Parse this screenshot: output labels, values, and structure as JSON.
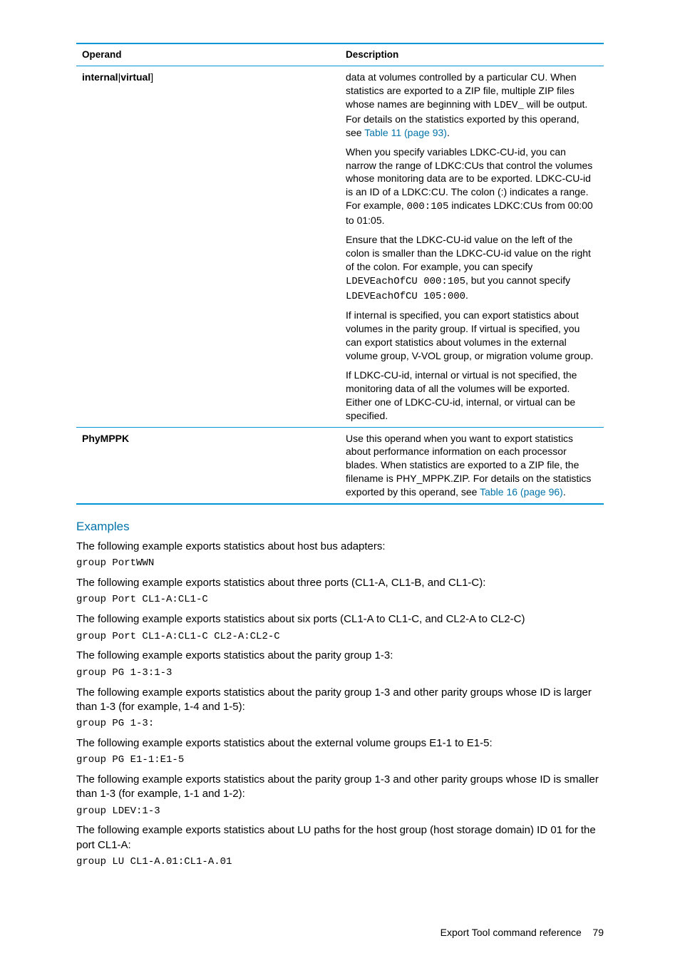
{
  "table": {
    "headers": {
      "operand": "Operand",
      "description": "Description"
    },
    "row1": {
      "operand_pre": "internal",
      "operand_sep": "|",
      "operand_post": "virtual",
      "operand_close": "]",
      "p1a": "data at volumes controlled by a particular CU. When statistics are exported to a ZIP file, multiple ZIP files whose names are beginning with ",
      "p1mono": "LDEV_",
      "p1b": " will be output. For details on the statistics exported by this operand, see ",
      "p1link": "Table 11 (page 93)",
      "p1c": ".",
      "p2a": "When you specify variables LDKC-CU-id, you can narrow the range of LDKC:CUs that control the volumes whose monitoring data are to be exported. LDKC-CU-id is an ID of a LDKC:CU. The colon (:) indicates a range. For example, ",
      "p2mono": "000:105",
      "p2b": " indicates LDKC:CUs from 00:00 to 01:05.",
      "p3a": "Ensure that the LDKC-CU-id value on the left of the colon is smaller than the LDKC-CU-id value on the right of the colon. For example, you can specify ",
      "p3m1": "LDEVEachOfCU 000:105",
      "p3b": ", but you cannot specify ",
      "p3m2": "LDEVEachOfCU 105:000",
      "p3c": ".",
      "p4": "If internal is specified, you can export statistics about volumes in the parity group. If virtual is specified, you can export statistics about volumes in the external volume group, V-VOL group, or migration volume group.",
      "p5": "If LDKC-CU-id, internal or virtual is not specified, the monitoring data of all the volumes will be exported. Either one of LDKC-CU-id, internal, or virtual can be specified."
    },
    "row2": {
      "operand": "PhyMPPK",
      "p1a": "Use this operand when you want to export statistics about performance information on each processor blades. When statistics are exported to a ZIP file, the filename is PHY_MPPK.ZIP. For details on the statistics exported by this operand, see ",
      "p1link": "Table 16 (page 96)",
      "p1b": "."
    }
  },
  "examples": {
    "heading": "Examples",
    "p1": "The following example exports statistics about host bus adapters:",
    "c1": "group PortWWN",
    "p2": "The following example exports statistics about three ports (CL1-A, CL1-B, and CL1-C):",
    "c2": "group Port CL1-A:CL1-C",
    "p3": "The following example exports statistics about six ports (CL1-A to CL1-C, and CL2-A to CL2-C)",
    "c3": "group Port CL1-A:CL1-C CL2-A:CL2-C",
    "p4": "The following example exports statistics about the parity group 1-3:",
    "c4": "group PG 1-3:1-3",
    "p5": "The following example exports statistics about the parity group 1-3 and other parity groups whose ID is larger than 1-3 (for example, 1-4 and 1-5):",
    "c5": "group PG 1-3:",
    "p6": "The following example exports statistics about the external volume groups E1-1 to E1-5:",
    "c6": "group PG E1-1:E1-5",
    "p7": "The following example exports statistics about the parity group 1-3 and other parity groups whose ID is smaller than 1-3 (for example, 1-1 and 1-2):",
    "c7": "group LDEV:1-3",
    "p8": "The following example exports statistics about LU paths for the host group (host storage domain) ID 01 for the port CL1-A:",
    "c8": "group LU CL1-A.01:CL1-A.01"
  },
  "footer": {
    "label": "Export Tool command reference",
    "page": "79"
  }
}
